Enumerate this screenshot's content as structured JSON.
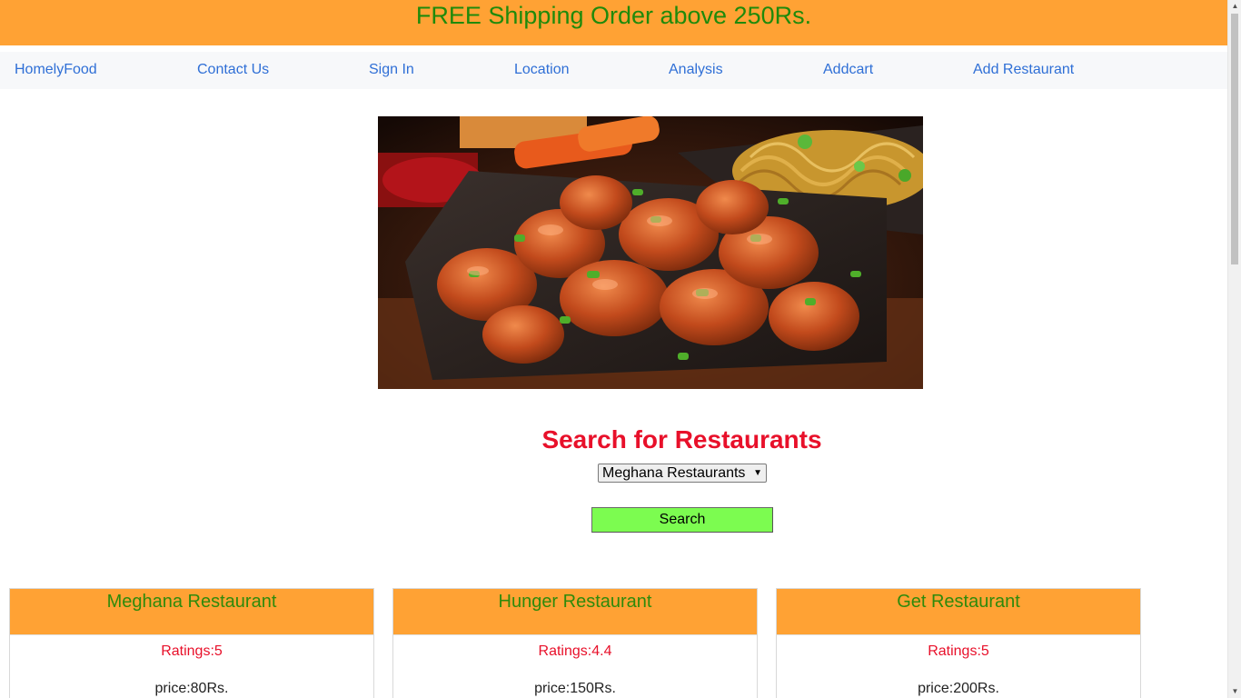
{
  "banner": {
    "text": "FREE Shipping Order above 250Rs."
  },
  "nav": {
    "items": [
      {
        "label": "HomelyFood"
      },
      {
        "label": "Contact Us"
      },
      {
        "label": "Sign In"
      },
      {
        "label": "Location"
      },
      {
        "label": "Analysis"
      },
      {
        "label": "Addcart"
      },
      {
        "label": "Add Restaurant"
      }
    ]
  },
  "hero": {
    "subject": "fried chicken with noodles"
  },
  "search": {
    "title": "Search for Restaurants",
    "selected": "Meghana Restaurants",
    "button_label": "Search"
  },
  "restaurants": [
    {
      "name": "Meghana Restaurant",
      "ratings": "Ratings:5",
      "price": "price:80Rs."
    },
    {
      "name": "Hunger Restaurant",
      "ratings": "Ratings:4.4",
      "price": "price:150Rs."
    },
    {
      "name": "Get Restaurant",
      "ratings": "Ratings:5",
      "price": "price:200Rs."
    }
  ],
  "colors": {
    "banner_bg": "#ffa234",
    "banner_text": "#1f8a0b",
    "nav_link": "#2f6fd6",
    "search_title": "#e8102a",
    "button_bg": "#7cfc50",
    "rating_text": "#e8102a"
  },
  "icons": {
    "select_arrow": "chevron-down-icon",
    "scroll_up": "scroll-up-arrow-icon",
    "scroll_down": "scroll-down-arrow-icon"
  }
}
